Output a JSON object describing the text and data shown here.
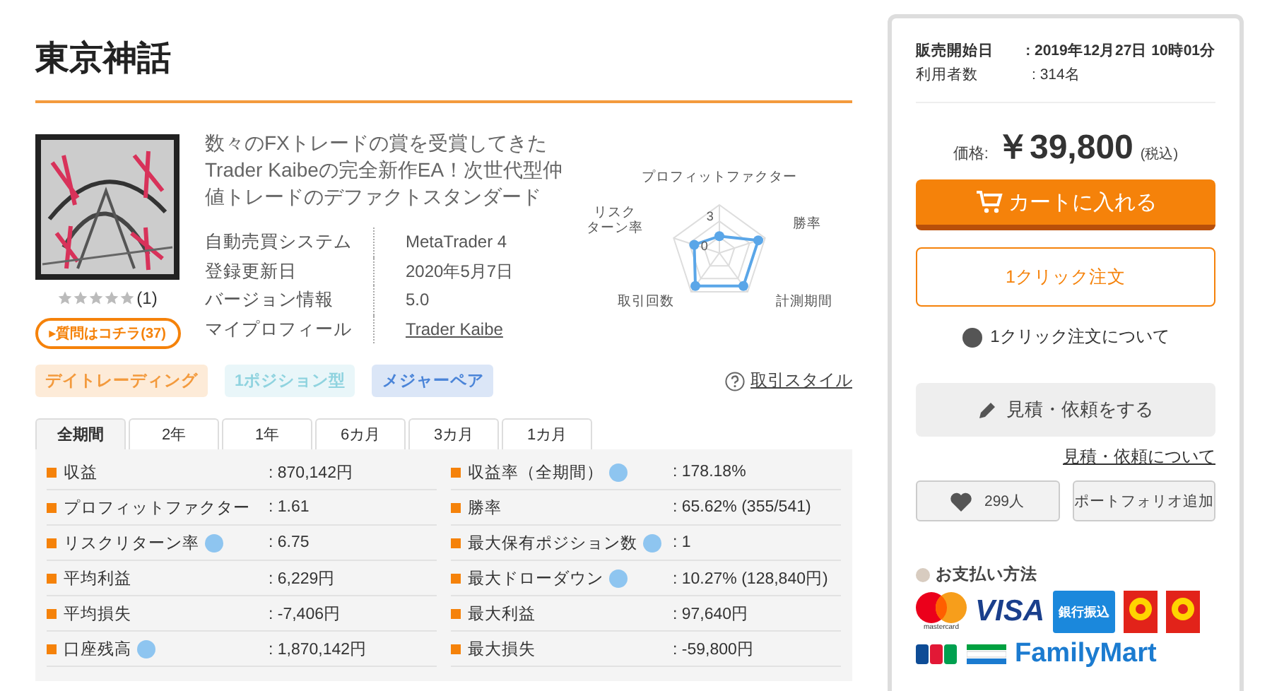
{
  "title": "東京神話",
  "product": {
    "description": "数々のFXトレードの賞を受賞してきたTrader Kaibeの完全新作EA！次世代型仲値トレードのデファクトスタンダード",
    "specs": [
      {
        "label": "自動売買システム",
        "value": "MetaTrader 4",
        "kind": "text"
      },
      {
        "label": "登録更新日",
        "value": "2020年5月7日",
        "kind": "text"
      },
      {
        "label": "バージョン情報",
        "value": "5.0",
        "kind": "text"
      },
      {
        "label": "マイプロフィール",
        "value": "Trader Kaibe",
        "kind": "link"
      }
    ],
    "stars": 0,
    "rating_count": "(1)",
    "question_marker": "▸",
    "question_button": "質問はコチラ(37)"
  },
  "radar": {
    "labels": [
      [
        "プロフィットファクター"
      ],
      [
        "勝率"
      ],
      [
        "計測期間"
      ],
      [
        "取引回数"
      ],
      [
        "リスク",
        "ターン率"
      ]
    ],
    "ticks": [
      "3",
      "0"
    ]
  },
  "tags": [
    {
      "label": "デイトレーディング",
      "color": "#f39a3d"
    },
    {
      "label": "1ポジション型",
      "color": "#8fd3df"
    },
    {
      "label": "メジャーペア",
      "color": "#4a84d8"
    }
  ],
  "style_link": "取引スタイル",
  "period_tabs": [
    {
      "label": "全期間",
      "selected": true
    },
    {
      "label": "2年",
      "selected": false
    },
    {
      "label": "1年",
      "selected": false
    },
    {
      "label": "6カ月",
      "selected": false
    },
    {
      "label": "3カ月",
      "selected": false
    },
    {
      "label": "1カ月",
      "selected": false
    }
  ],
  "stats": [
    {
      "label": "収益",
      "value": ": 870,142円",
      "help": false
    },
    {
      "label": "収益率（全期間）",
      "value": ": 178.18%",
      "help": true
    },
    {
      "label": "プロフィットファクター",
      "value": ": 1.61",
      "help": false
    },
    {
      "label": "勝率",
      "value": ": 65.62% (355/541)",
      "help": false
    },
    {
      "label": "リスクリターン率",
      "value": ": 6.75",
      "help": true
    },
    {
      "label": "最大保有ポジション数",
      "value": ": 1",
      "help": true
    },
    {
      "label": "平均利益",
      "value": ": 6,229円",
      "help": false
    },
    {
      "label": "最大ドローダウン",
      "value": ": 10.27% (128,840円)",
      "help": true
    },
    {
      "label": "平均損失",
      "value": ": -7,406円",
      "help": false
    },
    {
      "label": "最大利益",
      "value": ": 97,640円",
      "help": false
    },
    {
      "label": "口座残高",
      "value": ": 1,870,142円",
      "help": true
    },
    {
      "label": "最大損失",
      "value": ": -59,800円",
      "help": false
    }
  ],
  "sidebar": {
    "info": [
      {
        "label": "販売開始日",
        "value": ": 2019年12月27日 10時01分",
        "bold": true
      },
      {
        "label": "利用者数",
        "value": ": 314名",
        "bold": false
      }
    ],
    "price_label": "価格:",
    "price": "￥39,800",
    "tax": "(税込)",
    "cart_button": "カートに入れる",
    "one_click_button": "1クリック注文",
    "one_click_help": "1クリック注文について",
    "quote_button": "見積・依頼をする",
    "quote_link": "見積・依頼について",
    "like_button": "299人",
    "portfolio_button": "ポートフォリオ追加",
    "payment_title": "お支払い方法",
    "payments": [
      {
        "kind": "mastercard",
        "label": "mastercard"
      },
      {
        "kind": "visa",
        "label": "VISA"
      },
      {
        "kind": "bank",
        "label": "銀行振込"
      },
      {
        "kind": "daily"
      },
      {
        "kind": "daily"
      },
      {
        "kind": "jcb"
      },
      {
        "kind": "familymart",
        "label": "FamilyMart"
      }
    ]
  }
}
